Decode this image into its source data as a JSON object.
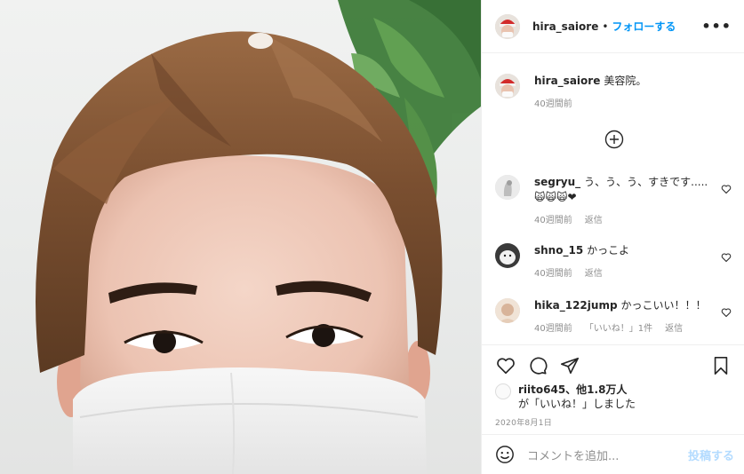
{
  "header": {
    "username": "hira_saiore",
    "separator": "•",
    "follow_label": "フォローする",
    "more_label": "•••"
  },
  "caption": {
    "username": "hira_saiore",
    "text": "美容院。",
    "time": "40週間前"
  },
  "comments": [
    {
      "username": "segryu_",
      "text": "う、う、う、すきです.....",
      "emoji": "🙀🙀🙀❤",
      "time": "40週間前",
      "reply": "返信",
      "likes": ""
    },
    {
      "username": "shno_15",
      "text": "かっこよ",
      "emoji": "",
      "time": "40週間前",
      "reply": "返信",
      "likes": ""
    },
    {
      "username": "hika_122jump",
      "text": "かっこいい！！！",
      "emoji": "",
      "time": "40週間前",
      "reply": "返信",
      "likes": "「いいね！」1件"
    }
  ],
  "likes": {
    "line1_bold": "riito645、他1.8万人",
    "line2": "が「いいね！」しました"
  },
  "date": "2020年8月1日",
  "add_comment": {
    "placeholder": "コメントを追加...",
    "post_label": "投稿する"
  },
  "colors": {
    "accent": "#0095f6",
    "post_disabled": "#b3dbff",
    "heart_red": "#e0245e",
    "muted": "#8e8e8e"
  },
  "icons": [
    "heart-icon",
    "comment-icon",
    "share-icon",
    "bookmark-icon",
    "plus-circle-icon",
    "emoji-icon"
  ]
}
